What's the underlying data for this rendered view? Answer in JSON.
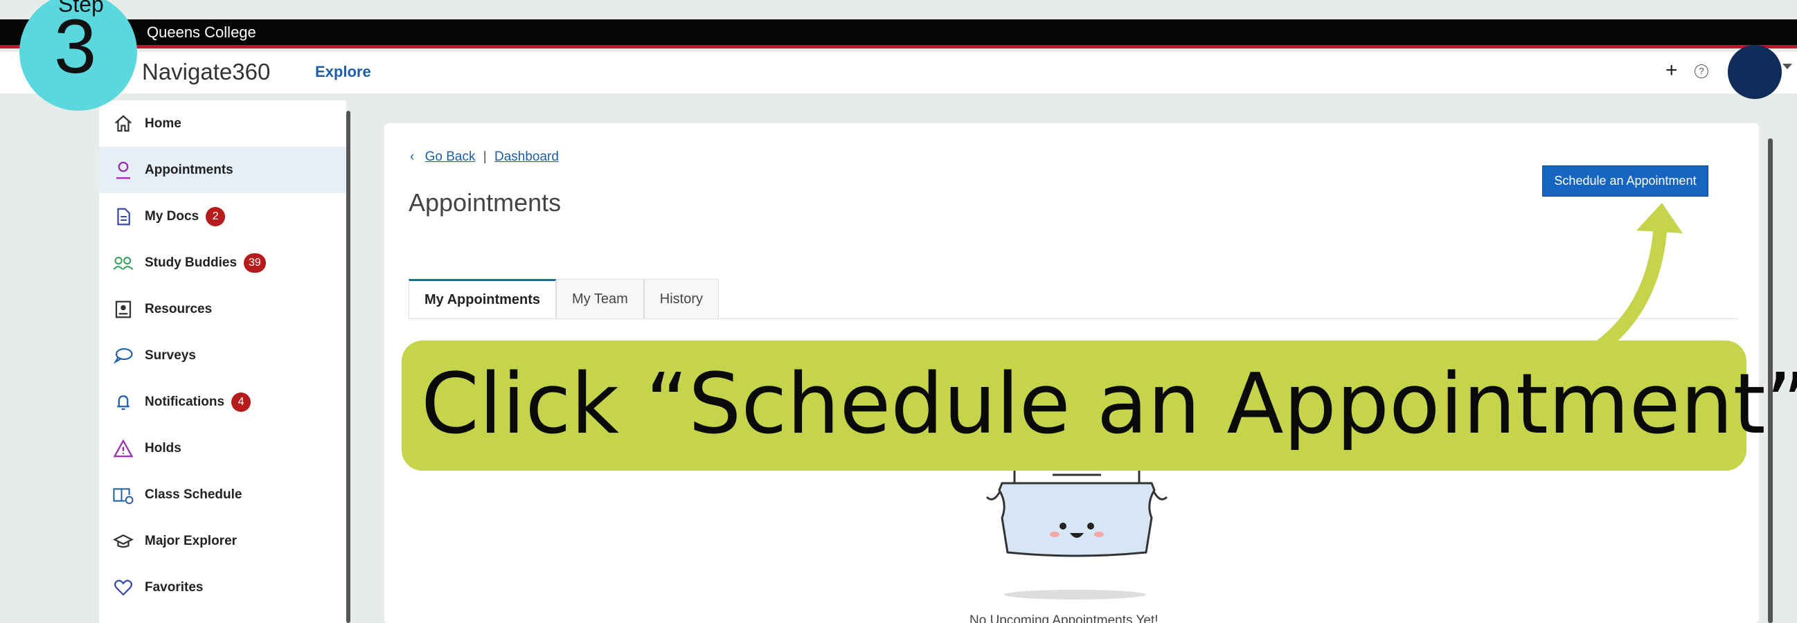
{
  "step": {
    "label": "Step",
    "number": "3"
  },
  "topbar": {
    "college": "Queens College"
  },
  "navbar": {
    "brand": "Navigate360",
    "explore": "Explore",
    "plus": "+",
    "help": "?"
  },
  "sidebar": {
    "items": [
      {
        "label": "Home",
        "icon": "home-icon",
        "badge": ""
      },
      {
        "label": "Appointments",
        "icon": "person-icon",
        "badge": ""
      },
      {
        "label": "My Docs",
        "icon": "document-icon",
        "badge": "2"
      },
      {
        "label": "Study Buddies",
        "icon": "people-icon",
        "badge": "39"
      },
      {
        "label": "Resources",
        "icon": "resources-icon",
        "badge": ""
      },
      {
        "label": "Surveys",
        "icon": "chat-bubble-icon",
        "badge": ""
      },
      {
        "label": "Notifications",
        "icon": "bell-icon",
        "badge": "4"
      },
      {
        "label": "Holds",
        "icon": "warning-icon",
        "badge": ""
      },
      {
        "label": "Class Schedule",
        "icon": "book-icon",
        "badge": ""
      },
      {
        "label": "Major Explorer",
        "icon": "graduation-cap-icon",
        "badge": ""
      },
      {
        "label": "Favorites",
        "icon": "heart-icon",
        "badge": ""
      }
    ]
  },
  "main": {
    "breadcrumb": {
      "back": "Go Back",
      "separator": "|",
      "dashboard": "Dashboard"
    },
    "title": "Appointments",
    "schedule_button": "Schedule an Appointment",
    "tabs": [
      {
        "label": "My Appointments",
        "active": true
      },
      {
        "label": "My Team",
        "active": false
      },
      {
        "label": "History",
        "active": false
      }
    ],
    "empty_message": "No Upcoming Appointments Yet!"
  },
  "banner": {
    "text": "Click “Schedule an Appointment”"
  },
  "colors": {
    "accent": "#1565c0",
    "banner": "#c5d44a",
    "step": "#5ad8de",
    "badge": "#b71c1c",
    "topbar_stripe": "#c8102e"
  }
}
